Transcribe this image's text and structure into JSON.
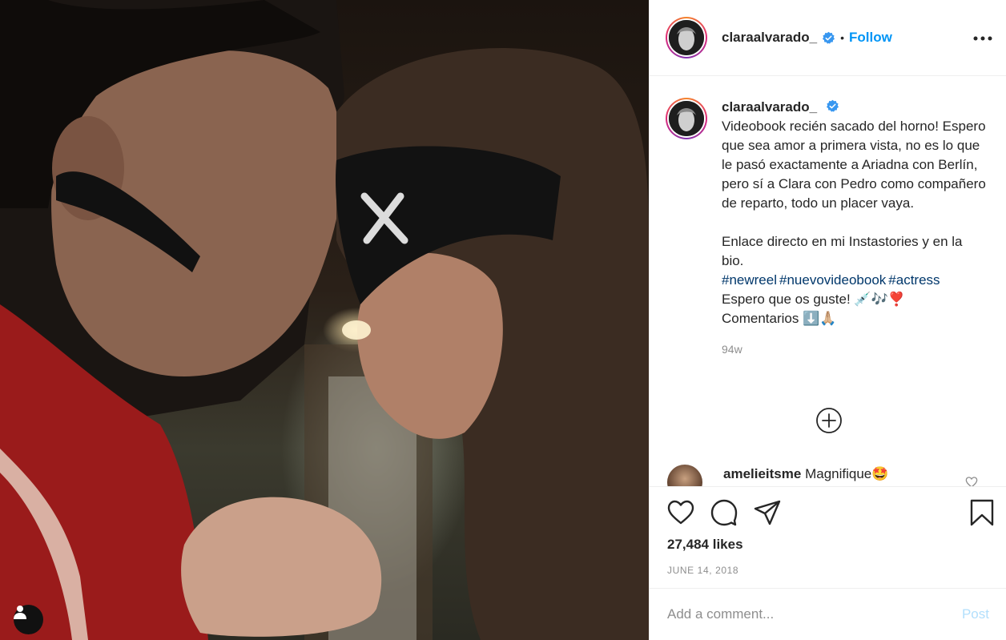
{
  "media": {
    "alt_icon": "user-tag-icon"
  },
  "header": {
    "username": "claraalvarado_",
    "verified_icon": "verified-badge-icon",
    "separator": "•",
    "follow_label": "Follow",
    "more_icon": "more-options-icon"
  },
  "caption": {
    "username": "claraalvarado_",
    "text": "Videobook recién sacado del horno! Espero que sea amor a primera vista, no es lo que le pasó exactamente a Ariadna con Berlín, pero sí a Clara con Pedro como compañero de reparto, todo un placer vaya.\n\nEnlace directo en mi Instastories y en la bio.",
    "hashtags": [
      "#newreel",
      "#nuevovideobook",
      "#actress"
    ],
    "line_guste": "Espero que os guste! 💉🎶❣️",
    "line_comentarios": "Comentarios ⬇️🙏🏼",
    "time_ago": "94w"
  },
  "load_more_icon": "plus-circle-icon",
  "comments": [
    {
      "username": "amelieitsme",
      "text": "Magnifique🤩"
    }
  ],
  "actions": {
    "like_icon": "heart-icon",
    "comment_icon": "comment-icon",
    "share_icon": "share-icon",
    "save_icon": "bookmark-icon"
  },
  "likes_text": "27,484 likes",
  "date_text": "JUNE 14, 2018",
  "add_comment": {
    "placeholder": "Add a comment...",
    "post_label": "Post"
  },
  "colors": {
    "accent": "#0095f6",
    "post_disabled": "#b2dffc",
    "hashtag": "#00376b",
    "muted": "#8e8e8e"
  }
}
